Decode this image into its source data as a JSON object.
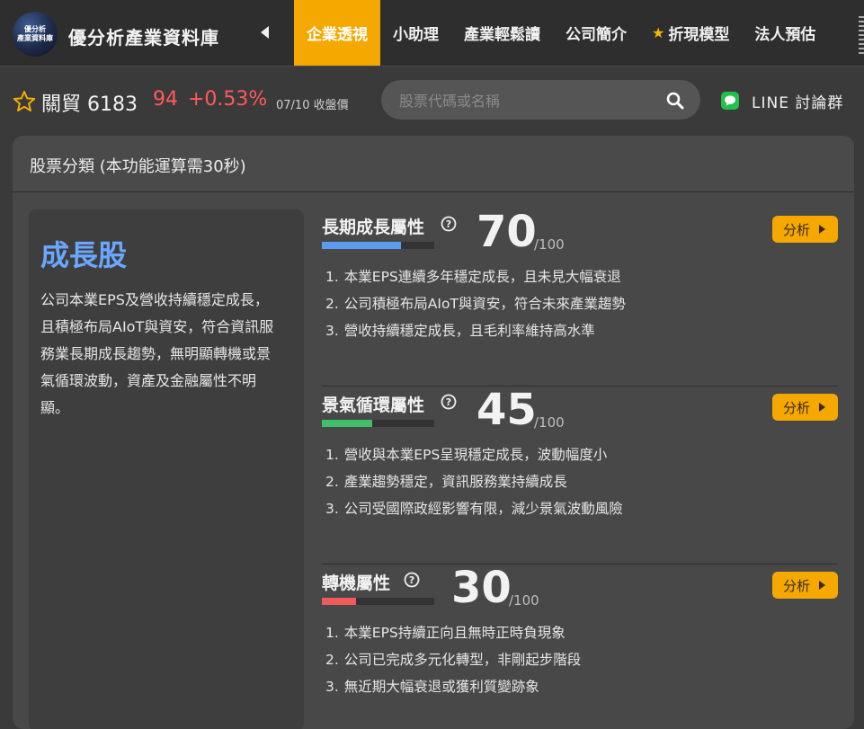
{
  "site": {
    "logo_text_line1": "優分析",
    "logo_text_line2": "產業資料庫",
    "title": "優分析產業資料庫"
  },
  "nav": {
    "tabs": [
      {
        "label": "企業透視",
        "active": true
      },
      {
        "label": "小助理",
        "active": false
      },
      {
        "label": "產業輕鬆讀",
        "active": false
      },
      {
        "label": "公司簡介",
        "active": false
      },
      {
        "label": "折現模型",
        "active": false,
        "icon": "star-icon"
      },
      {
        "label": "法人預估",
        "active": false
      }
    ]
  },
  "stock": {
    "name_code": "關貿 6183",
    "price": "94",
    "change": "+0.53%",
    "date_label": "07/10 收盤價"
  },
  "search": {
    "placeholder": "股票代碼或名稱"
  },
  "line_group": {
    "label": "LINE 討論群"
  },
  "card": {
    "title": "股票分類 (本功能運算需30秒)"
  },
  "summary": {
    "type": "成長股",
    "description": "公司本業EPS及營收持續穩定成長，且積極布局AIoT與資安，符合資訊服務業長期成長趨勢，無明顯轉機或景氣循環波動，資產及金融屬性不明顯。"
  },
  "attributes": [
    {
      "name": "長期成長屬性",
      "score": "70",
      "score_value": 70,
      "max": "/100",
      "bar_color": "#5b9bf0",
      "button": "分析",
      "reasons": [
        "本業EPS連續多年穩定成長，且未見大幅衰退",
        "公司積極布局AIoT與資安，符合未來產業趨勢",
        "營收持續穩定成長，且毛利率維持高水準"
      ]
    },
    {
      "name": "景氣循環屬性",
      "score": "45",
      "score_value": 45,
      "max": "/100",
      "bar_color": "#3fbf6a",
      "button": "分析",
      "reasons": [
        "營收與本業EPS呈現穩定成長，波動幅度小",
        "產業趨勢穩定，資訊服務業持續成長",
        "公司受國際政經影響有限，減少景氣波動風險"
      ]
    },
    {
      "name": "轉機屬性",
      "score": "30",
      "score_value": 30,
      "max": "/100",
      "bar_color": "#f05a5a",
      "button": "分析",
      "reasons": [
        "本業EPS持續正向且無時正時負現象",
        "公司已完成多元化轉型，非剛起步階段",
        "無近期大幅衰退或獲利質變跡象"
      ]
    }
  ]
}
